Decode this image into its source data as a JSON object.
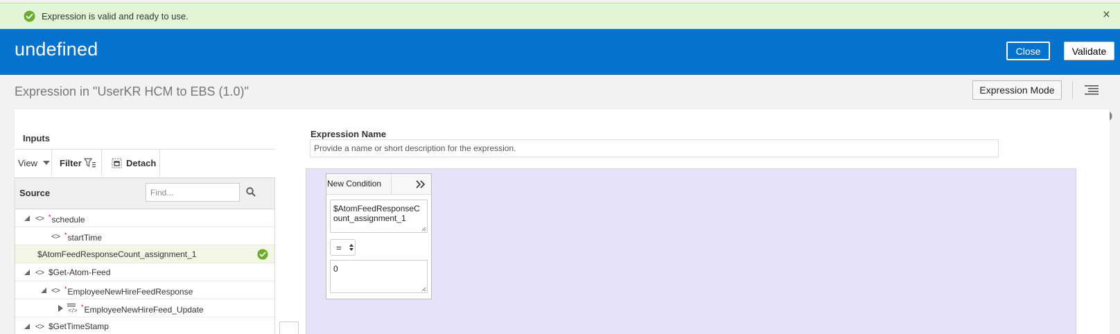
{
  "banner": {
    "message": "Expression is valid and ready to use.",
    "close_glyph": "×",
    "status_color": "#6aac2b"
  },
  "header": {
    "title": "undefined",
    "close_label": "Close",
    "validate_label": "Validate",
    "brand_color": "#0572ce"
  },
  "page": {
    "subtitle": "Expression in \"UserKR HCM to EBS (1.0)\"",
    "mode_label": "Expression Mode",
    "menu_icon": "hamburger-icon",
    "help_icon": "help-icon"
  },
  "inputs": {
    "title": "Inputs",
    "toolbar": {
      "view_label": "View",
      "filter_label": "Filter",
      "detach_label": "Detach"
    },
    "source_label": "Source",
    "find_placeholder": "Find...",
    "tree": [
      {
        "label": "schedule",
        "required": "*",
        "depth": 0,
        "toggle": "expanded",
        "node_icon": "angle-brackets-icon"
      },
      {
        "label": "startTime",
        "required": "*",
        "depth": 1,
        "toggle": "none",
        "node_icon": "angle-brackets-icon"
      },
      {
        "label": "$AtomFeedResponseCount_assignment_1",
        "required": "",
        "depth": 0,
        "toggle": "none",
        "node_icon": "none",
        "selected": true,
        "status": "valid-check-icon"
      },
      {
        "label": "$Get-Atom-Feed",
        "required": "",
        "depth": 0,
        "toggle": "expanded",
        "node_icon": "angle-brackets-icon"
      },
      {
        "label": "EmployeeNewHireFeedResponse",
        "required": "*",
        "depth": 1,
        "toggle": "expanded",
        "node_icon": "angle-brackets-icon"
      },
      {
        "label": "EmployeeNewHireFeed_Update",
        "required": "*",
        "depth": 2,
        "toggle": "collapsed",
        "node_icon": "repeating-element-icon"
      },
      {
        "label": "$GetTimeStamp",
        "required": "",
        "depth": 0,
        "toggle": "expanded",
        "node_icon": "angle-brackets-icon"
      }
    ]
  },
  "expression": {
    "name_label": "Expression Name",
    "name_placeholder": "Provide a name or short description for the expression.",
    "condition": {
      "title": "New Condition",
      "left_operand": "$AtomFeedResponseCount_assignment_1",
      "operator": "=",
      "right_operand": "0"
    },
    "canvas_color": "#e6e3f8"
  }
}
